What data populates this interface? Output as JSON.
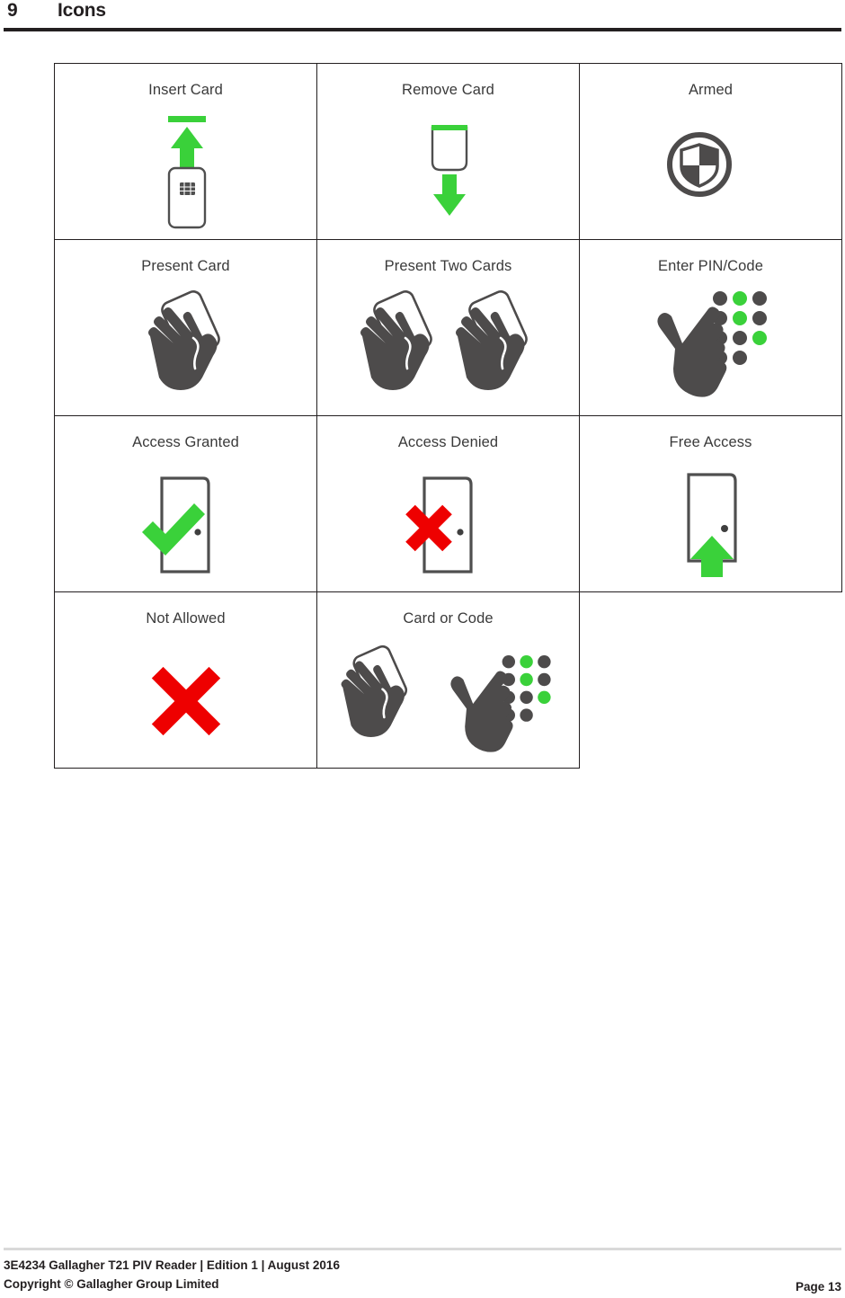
{
  "heading": {
    "number": "9",
    "title": "Icons"
  },
  "table": {
    "rows": [
      [
        {
          "label": "Insert Card",
          "icon": "insert-card-icon"
        },
        {
          "label": "Remove Card",
          "icon": "remove-card-icon"
        },
        {
          "label": "Armed",
          "icon": "armed-shield-icon"
        }
      ],
      [
        {
          "label": "Present Card",
          "icon": "present-card-icon"
        },
        {
          "label": "Present Two Cards",
          "icon": "present-two-cards-icon"
        },
        {
          "label": "Enter PIN/Code",
          "icon": "enter-pin-code-icon"
        }
      ],
      [
        {
          "label": "Access Granted",
          "icon": "access-granted-icon"
        },
        {
          "label": "Access Denied",
          "icon": "access-denied-icon"
        },
        {
          "label": "Free Access",
          "icon": "free-access-icon"
        }
      ],
      [
        {
          "label": "Not Allowed",
          "icon": "not-allowed-icon"
        },
        {
          "label": "Card or Code",
          "icon": "card-or-code-icon"
        },
        {
          "label": "",
          "icon": ""
        }
      ]
    ]
  },
  "footer": {
    "line1": "3E4234 Gallagher T21 PIV Reader | Edition 1 | August 2016",
    "line2": "Copyright © Gallagher Group Limited",
    "page": "Page 13"
  },
  "colors": {
    "green": "#3ad13a",
    "red": "#ee0000",
    "hand_gray": "#4d4b4b",
    "outline_gray": "#4f4f4f",
    "text": "#231f20",
    "label_gray": "#3a3a3a",
    "rule": "#231f20",
    "footer_rule": "#d9d9d9"
  }
}
